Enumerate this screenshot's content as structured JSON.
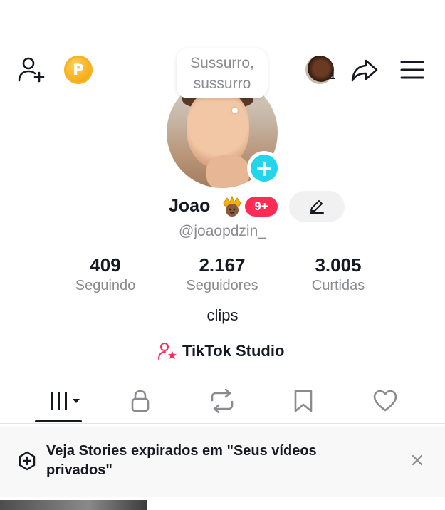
{
  "header": {
    "speech_bubble_line1": "Sussurro,",
    "speech_bubble_line2": "sussurro",
    "friends_avatar_count": "1",
    "coin_letter": "P"
  },
  "profile": {
    "name": "Joao",
    "notification_badge": "9+",
    "handle": "@joaopdzin_",
    "bio": "clips"
  },
  "stats": [
    {
      "value": "409",
      "label": "Seguindo"
    },
    {
      "value": "2.167",
      "label": "Seguidores"
    },
    {
      "value": "3.005",
      "label": "Curtidas"
    }
  ],
  "studio": {
    "label": "TikTok Studio"
  },
  "tabs": [
    {
      "icon": "grid-icon",
      "active": true
    },
    {
      "icon": "lock-icon",
      "active": false
    },
    {
      "icon": "repost-icon",
      "active": false
    },
    {
      "icon": "bookmark-icon",
      "active": false
    },
    {
      "icon": "heart-icon",
      "active": false
    }
  ],
  "banner": {
    "text": "Veja Stories expirados em \"Seus vídeos privados\""
  },
  "colors": {
    "accent_red": "#fe2c55",
    "accent_cyan": "#20d5ec",
    "text_primary": "#161823",
    "text_secondary": "#8a8b91",
    "coin_gold": "#f7a712"
  }
}
